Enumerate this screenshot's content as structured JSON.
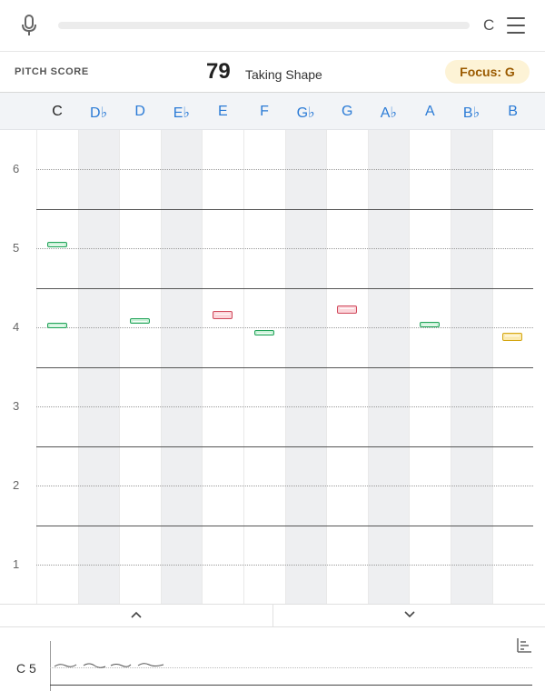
{
  "header": {
    "key": "C",
    "icons": {
      "mic": "microphone-icon",
      "menu": "hamburger-menu-icon"
    }
  },
  "score": {
    "label": "PITCH SCORE",
    "value": "79",
    "status": "Taking Shape",
    "focus": "Focus:  G"
  },
  "notes": [
    "C",
    "D♭",
    "D",
    "E♭",
    "E",
    "F",
    "G♭",
    "G",
    "A♭",
    "A",
    "B♭",
    "B"
  ],
  "active_note": "C",
  "octaves": [
    "6",
    "5",
    "4",
    "3",
    "2",
    "1"
  ],
  "marks": [
    {
      "note": "C",
      "octave_pos": 5.05,
      "status": "green"
    },
    {
      "note": "C",
      "octave_pos": 4.02,
      "status": "green"
    },
    {
      "note": "D",
      "octave_pos": 4.08,
      "status": "green"
    },
    {
      "note": "E",
      "octave_pos": 4.15,
      "status": "red"
    },
    {
      "note": "F",
      "octave_pos": 3.93,
      "status": "green"
    },
    {
      "note": "G",
      "octave_pos": 4.22,
      "status": "red"
    },
    {
      "note": "A",
      "octave_pos": 4.03,
      "status": "green"
    },
    {
      "note": "B",
      "octave_pos": 3.88,
      "status": "yellow"
    }
  ],
  "colors": {
    "accent": "#2b7bd6",
    "green_border": "#22a35a",
    "green_fill": "#c8f0d6",
    "red_border": "#d0475a",
    "red_fill": "#fbd5da",
    "yellow_border": "#d4a612",
    "yellow_fill": "#fbeab0",
    "focus_bg": "#fdf3d6",
    "focus_text": "#9a5a00"
  },
  "trace": {
    "label": "C 5",
    "icon": "stats-chart-icon"
  },
  "scroll": {
    "up_icon": "chevron-up-icon",
    "down_icon": "chevron-down-icon"
  }
}
